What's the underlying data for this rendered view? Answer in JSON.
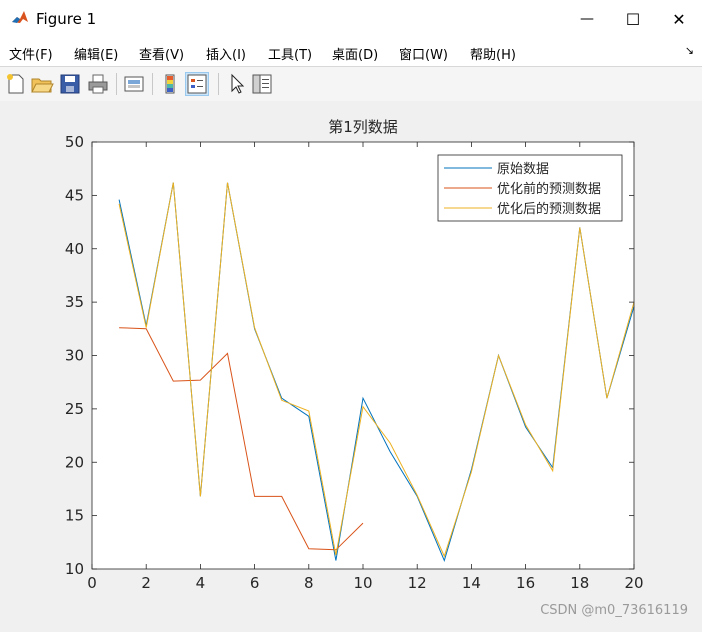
{
  "window": {
    "title": "Figure 1",
    "minimize_glyph": "—",
    "maximize_glyph": "☐",
    "close_glyph": "✕"
  },
  "menu": [
    {
      "label": "文件(F)"
    },
    {
      "label": "编辑(E)"
    },
    {
      "label": "查看(V)"
    },
    {
      "label": "插入(I)"
    },
    {
      "label": "工具(T)"
    },
    {
      "label": "桌面(D)"
    },
    {
      "label": "窗口(W)"
    },
    {
      "label": "帮助(H)"
    }
  ],
  "menu_arrow": "↘",
  "toolbar": [
    {
      "icon": "new-figure-icon"
    },
    {
      "icon": "open-file-icon"
    },
    {
      "icon": "save-icon"
    },
    {
      "icon": "print-icon"
    },
    {
      "icon": "link-plot-icon"
    },
    {
      "icon": "insert-colorbar-icon"
    },
    {
      "icon": "insert-legend-icon"
    },
    {
      "icon": "edit-plot-icon"
    },
    {
      "icon": "property-inspector-icon"
    }
  ],
  "watermark": "CSDN @m0_73616119",
  "colors": {
    "series1": "#0072BD",
    "series2": "#D95319",
    "series3": "#EDB120"
  },
  "chart_data": {
    "type": "line",
    "title": "第1列数据",
    "xlabel": "",
    "ylabel": "",
    "xlim": [
      0,
      20
    ],
    "ylim": [
      10,
      50
    ],
    "xticks": [
      0,
      2,
      4,
      6,
      8,
      10,
      12,
      14,
      16,
      18,
      20
    ],
    "yticks": [
      10,
      15,
      20,
      25,
      30,
      35,
      40,
      45,
      50
    ],
    "grid": false,
    "legend_position": "top-right",
    "series": [
      {
        "name": "原始数据",
        "x": [
          1,
          2,
          3,
          4,
          5,
          6,
          7,
          8,
          9,
          10,
          11,
          12,
          13,
          14,
          15,
          16,
          17,
          18,
          19,
          20
        ],
        "y": [
          44.6,
          32.8,
          46.2,
          16.8,
          46.2,
          32.5,
          26.0,
          24.3,
          10.8,
          26.0,
          21.0,
          16.8,
          10.8,
          19.3,
          30.0,
          23.3,
          19.5,
          42.0,
          26.0,
          34.6
        ]
      },
      {
        "name": "优化前的预测数据",
        "x": [
          1,
          2,
          3,
          4,
          5,
          6,
          7,
          8,
          9,
          10
        ],
        "y": [
          32.6,
          32.5,
          27.6,
          27.7,
          30.2,
          16.8,
          16.8,
          11.9,
          11.8,
          14.3
        ]
      },
      {
        "name": "优化后的预测数据",
        "x": [
          1,
          2,
          3,
          4,
          5,
          6,
          7,
          8,
          9,
          10,
          11,
          12,
          13,
          14,
          15,
          16,
          17,
          18,
          19,
          20
        ],
        "y": [
          44.2,
          32.6,
          46.2,
          16.8,
          46.2,
          32.6,
          25.8,
          24.8,
          11.3,
          25.2,
          21.8,
          16.9,
          11.2,
          19.1,
          30.0,
          23.5,
          19.2,
          42.0,
          26.0,
          35.0
        ]
      }
    ]
  }
}
